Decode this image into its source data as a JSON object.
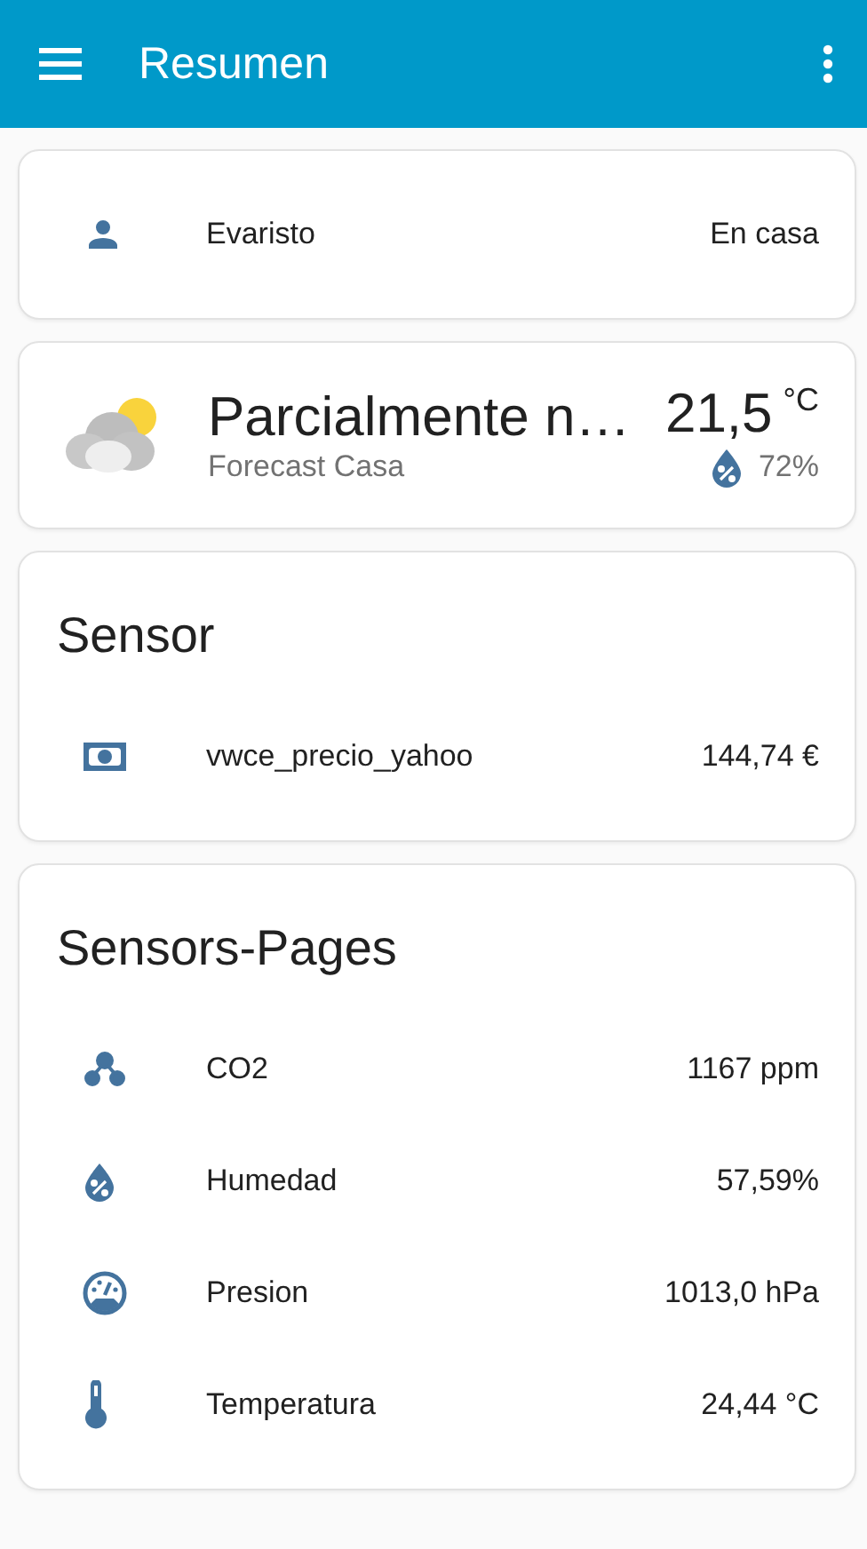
{
  "header": {
    "title": "Resumen"
  },
  "person_card": {
    "name": "Evaristo",
    "state": "En casa"
  },
  "weather_card": {
    "condition": "Parcialmente n…",
    "name": "Forecast Casa",
    "temperature": "21,5",
    "unit": "°C",
    "humidity": "72%"
  },
  "cards": [
    {
      "title": "Sensor",
      "entities": [
        {
          "kind": "cash",
          "name": "vwce_precio_yahoo",
          "value": "144,74 €"
        }
      ]
    },
    {
      "title": "Sensors-Pages",
      "entities": [
        {
          "kind": "molecule",
          "name": "CO2",
          "value": "1167 ppm"
        },
        {
          "kind": "humidity",
          "name": "Humedad",
          "value": "57,59%"
        },
        {
          "kind": "gauge",
          "name": "Presion",
          "value": "1013,0 hPa"
        },
        {
          "kind": "thermometer",
          "name": "Temperatura",
          "value": "24,44 °C"
        }
      ]
    }
  ]
}
